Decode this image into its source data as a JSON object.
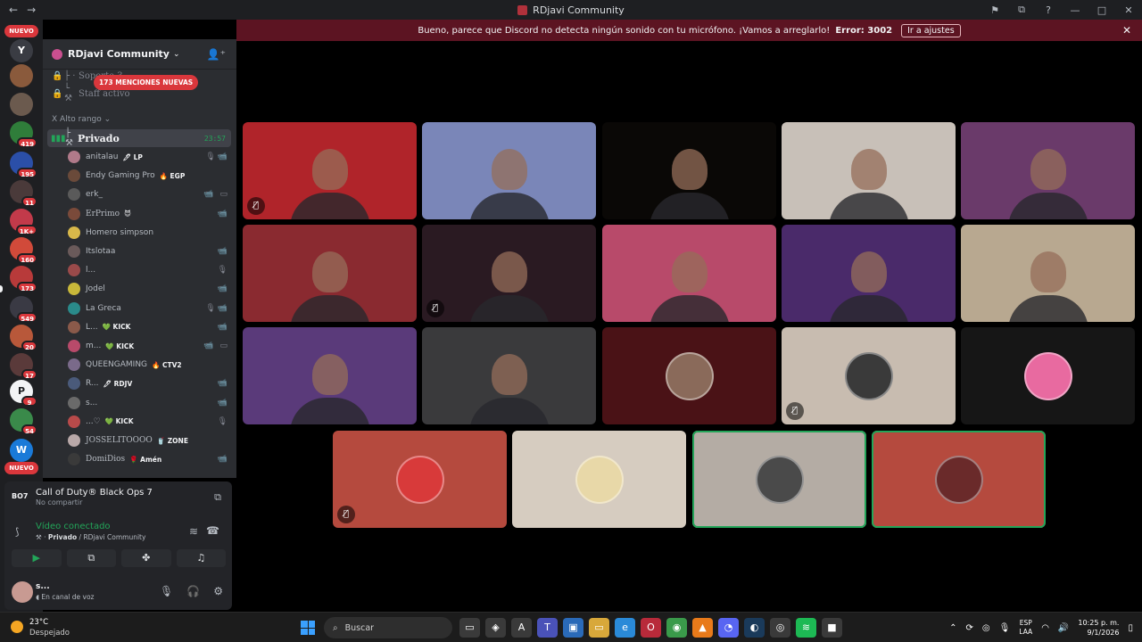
{
  "window": {
    "title": "RDjavi Community",
    "back": "←",
    "forward": "→",
    "controls": [
      "⚑",
      "⧉",
      "?",
      "—",
      "□",
      "✕"
    ]
  },
  "banner": {
    "message": "Bueno, parece que Discord no detecta ningún sonido con tu micrófono. ¡Vamos a arreglarlo!",
    "error": "Error: 3002",
    "action": "Ir a ajustes",
    "close": "✕"
  },
  "rail": {
    "top_badge": "NUEVO",
    "bottom_badge": "NUEVO",
    "servers": [
      {
        "badge": "",
        "color": "#3a3c43",
        "glyph": "Y"
      },
      {
        "badge": "",
        "color": "#8a5a3c",
        "glyph": ""
      },
      {
        "badge": "",
        "color": "#6b5a4e",
        "glyph": ""
      },
      {
        "badge": "419",
        "color": "#2f7d3a",
        "glyph": ""
      },
      {
        "badge": "195",
        "color": "#2b4fa8",
        "glyph": ""
      },
      {
        "badge": "11",
        "color": "#4a3a3a",
        "glyph": ""
      },
      {
        "badge": "1K+",
        "color": "#c23a4a",
        "glyph": ""
      },
      {
        "badge": "160",
        "color": "#d14a3a",
        "glyph": ""
      },
      {
        "badge": "173",
        "color": "#b83a3a",
        "glyph": ""
      },
      {
        "badge": "549",
        "color": "#3a3a44",
        "glyph": ""
      },
      {
        "badge": "20",
        "color": "#b8583a",
        "glyph": ""
      },
      {
        "badge": "17",
        "color": "#5a3a3a",
        "glyph": ""
      },
      {
        "badge": "9",
        "color": "#f2f3f5",
        "glyph": "P"
      },
      {
        "badge": "54",
        "color": "#3a8a4a",
        "glyph": ""
      },
      {
        "badge": "",
        "color": "#1a7ad8",
        "glyph": "W"
      }
    ]
  },
  "sidebar": {
    "server_name": "RDjavi Community",
    "mentions_badge": "173 MENCIONES NUEVAS",
    "channels_locked": [
      {
        "name": "Soporte 3"
      },
      {
        "name": "Staff activo"
      }
    ],
    "category": "Alto rango",
    "active_channel": {
      "name": "Privado",
      "time": "23:57"
    },
    "users": [
      {
        "name": "anitalau",
        "tag": "🖊 LP",
        "color": "#b07a8a",
        "status": "🎙📹"
      },
      {
        "name": "Endy Gaming Pro",
        "tag": "🔥 EGP",
        "color": "#6a4a3a",
        "status": ""
      },
      {
        "name": "erk_",
        "tag": "",
        "color": "#5a5a5a",
        "status": "📹 ▭"
      },
      {
        "name": "ErPrimo",
        "tag": "😈",
        "color": "#7a4a3a",
        "status": "📹"
      },
      {
        "name": "Homero simpson",
        "tag": "",
        "color": "#d8b84a",
        "status": ""
      },
      {
        "name": "Itslotaa",
        "tag": "",
        "color": "#6a5a5a",
        "status": "📹"
      },
      {
        "name": "l...",
        "tag": "",
        "color": "#9a4a4a",
        "status": "🎙"
      },
      {
        "name": "Jodel",
        "tag": "",
        "color": "#c8b83a",
        "status": "📹"
      },
      {
        "name": "La Greca",
        "tag": "",
        "color": "#2a8a8a",
        "status": "🎙📹"
      },
      {
        "name": "L...",
        "tag": "💚 KICK",
        "color": "#8a5a4a",
        "status": "📹"
      },
      {
        "name": "m...",
        "tag": "💚 KICK",
        "color": "#b84a6a",
        "status": "📹 ▭"
      },
      {
        "name": "QUEENGAMING",
        "tag": "🔥 CTV2",
        "color": "#7a6a8a",
        "status": ""
      },
      {
        "name": "R...",
        "tag": "🖊 RDJV",
        "color": "#4a5a7a",
        "status": "📹"
      },
      {
        "name": "s...",
        "tag": "",
        "color": "#6a6a6a",
        "status": "📹"
      },
      {
        "name": "...♡",
        "tag": "💚 KICK",
        "color": "#b84a4a",
        "status": "🎙"
      },
      {
        "name": "JOSSELITOOOO",
        "tag": "🥤 ZONE",
        "color": "#b8a8a8",
        "status": ""
      },
      {
        "name": "DomiDios",
        "tag": "🌹 Amén",
        "color": "#3a3a3a",
        "status": "📹"
      }
    ]
  },
  "activity": {
    "game_icon": "BO7",
    "game_title": "Call of Duty® Black Ops 7",
    "game_sub": "No compartir",
    "voice_status": "Vídeo conectado",
    "voice_channel": "Privado",
    "voice_server": "/ RDjavi Community"
  },
  "user_panel": {
    "name": "s...",
    "status": "En canal de voz"
  },
  "tiles": [
    {
      "bg": "#b0242a",
      "type": "cam",
      "mute": true
    },
    {
      "bg": "#7a86b8",
      "type": "cam",
      "mute": false
    },
    {
      "bg": "#0a0806",
      "type": "cam",
      "mute": false
    },
    {
      "bg": "#c8c0b8",
      "type": "cam",
      "mute": false
    },
    {
      "bg": "#6a3a6a",
      "type": "cam",
      "mute": false
    },
    {
      "bg": "#8a2a30",
      "type": "cam",
      "mute": false
    },
    {
      "bg": "#2a1a22",
      "type": "cam",
      "mute": true
    },
    {
      "bg": "#b84a6a",
      "type": "cam",
      "mute": false
    },
    {
      "bg": "#4a2a6a",
      "type": "cam",
      "mute": false
    },
    {
      "bg": "#b8a890",
      "type": "cam",
      "mute": false
    },
    {
      "bg": "#5a3a7a",
      "type": "cam",
      "mute": false
    },
    {
      "bg": "#3a3a3c",
      "type": "cam",
      "mute": false
    },
    {
      "bg": "#4a1216",
      "type": "avatar",
      "avatar": "#8a6a5a",
      "mute": false
    },
    {
      "bg": "#c8bcb0",
      "type": "avatar",
      "avatar": "#3a3a3a",
      "mute": true
    },
    {
      "bg": "#161616",
      "type": "avatar",
      "avatar": "#e86aa0",
      "mute": false
    },
    {
      "bg": "#b54a3e",
      "type": "avatar",
      "avatar": "#d83a3a",
      "mute": true
    },
    {
      "bg": "#d6ccc0",
      "type": "avatar",
      "avatar": "#e8d8a8",
      "mute": false
    },
    {
      "bg": "#b4aca4",
      "type": "avatar",
      "avatar": "#4a4a4a",
      "mute": false,
      "speaking": true
    },
    {
      "bg": "#b54a3e",
      "type": "avatar",
      "avatar": "#6a2a2a",
      "mute": false,
      "speaking": true
    }
  ],
  "taskbar": {
    "temperature": "23°C",
    "condition": "Despejado",
    "search_placeholder": "Buscar",
    "lang1": "ESP",
    "lang2": "LAA",
    "time": "10:25 p. m.",
    "date": "9/1/2026",
    "apps": [
      {
        "name": "task-view",
        "color": "#3a3a3a",
        "glyph": "▭"
      },
      {
        "name": "copilot",
        "color": "#3a3a3a",
        "glyph": "◈"
      },
      {
        "name": "app-a",
        "color": "#3a3a3a",
        "glyph": "A"
      },
      {
        "name": "teams",
        "color": "#4a52b8",
        "glyph": "T"
      },
      {
        "name": "store",
        "color": "#2a6ab8",
        "glyph": "▣"
      },
      {
        "name": "explorer",
        "color": "#d8a83a",
        "glyph": "▭"
      },
      {
        "name": "edge",
        "color": "#2a8ad8",
        "glyph": "e"
      },
      {
        "name": "opera",
        "color": "#b82a3a",
        "glyph": "O"
      },
      {
        "name": "chrome",
        "color": "#3a9a4a",
        "glyph": "◉"
      },
      {
        "name": "vlc",
        "color": "#e87a1a",
        "glyph": "▲"
      },
      {
        "name": "discord",
        "color": "#5865f2",
        "glyph": "◔"
      },
      {
        "name": "steam",
        "color": "#1a3a5a",
        "glyph": "◐"
      },
      {
        "name": "obs",
        "color": "#3a3a3a",
        "glyph": "◎"
      },
      {
        "name": "spotify",
        "color": "#1db954",
        "glyph": "≋"
      },
      {
        "name": "cod",
        "color": "#3a3a3a",
        "glyph": "■"
      }
    ]
  }
}
